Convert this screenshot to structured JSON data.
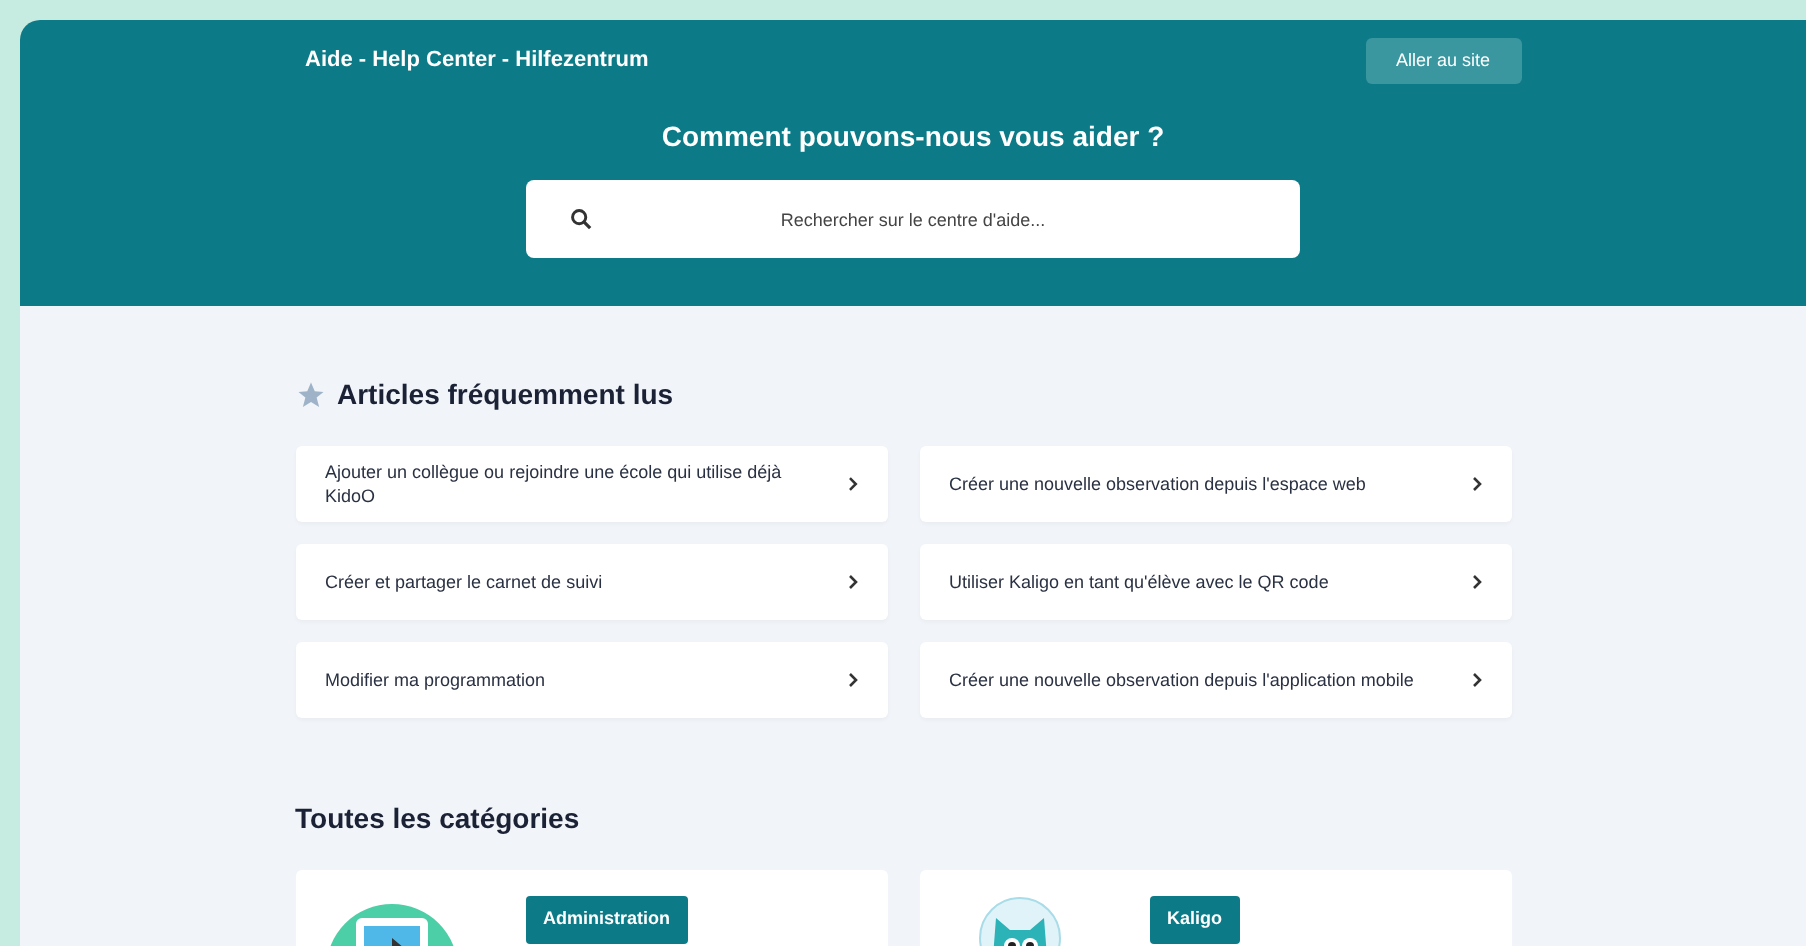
{
  "header": {
    "title": "Aide - Help Center - Hilfezentrum",
    "site_button": "Aller au site",
    "heading": "Comment pouvons-nous vous aider ?",
    "search": {
      "placeholder": "Rechercher sur le centre d'aide..."
    }
  },
  "popular": {
    "title": "Articles fréquemment lus",
    "articles": [
      {
        "label": "Ajouter un collègue ou rejoindre une école qui utilise déjà KidoO"
      },
      {
        "label": "Créer une nouvelle observation depuis l'espace web"
      },
      {
        "label": "Créer et partager le carnet de suivi"
      },
      {
        "label": "Utiliser Kaligo en tant qu'élève avec le QR code"
      },
      {
        "label": "Modifier ma programmation"
      },
      {
        "label": "Créer une nouvelle observation depuis l'application mobile"
      }
    ]
  },
  "categories": {
    "title": "Toutes les catégories",
    "items": [
      {
        "kind": "computer",
        "label": "Administration"
      },
      {
        "kind": "mascot",
        "label": "Kaligo"
      }
    ]
  }
}
